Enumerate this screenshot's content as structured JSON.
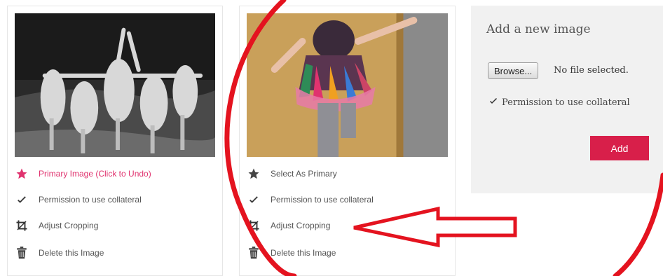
{
  "cards": [
    {
      "photo": "bw-dancers-photo",
      "primary_label": "Primary Image (Click to Undo)",
      "permission_label": "Permission to use collateral",
      "crop_label": "Adjust Cropping",
      "delete_label": "Delete this Image"
    },
    {
      "photo": "child-costume-photo",
      "primary_label": "Select As Primary",
      "permission_label": "Permission to use collateral",
      "crop_label": "Adjust Cropping",
      "delete_label": "Delete this Image"
    }
  ],
  "add_panel": {
    "title": "Add a new image",
    "browse_label": "Browse...",
    "file_status": "No file selected.",
    "permission_label": "Permission to use collateral",
    "permission_checked": true,
    "add_label": "Add"
  },
  "colors": {
    "accent_pink": "#e0336f",
    "add_button": "#d81f4a",
    "annotation_red": "#e4131f"
  },
  "annotations": [
    "red-circle",
    "red-arrow"
  ]
}
